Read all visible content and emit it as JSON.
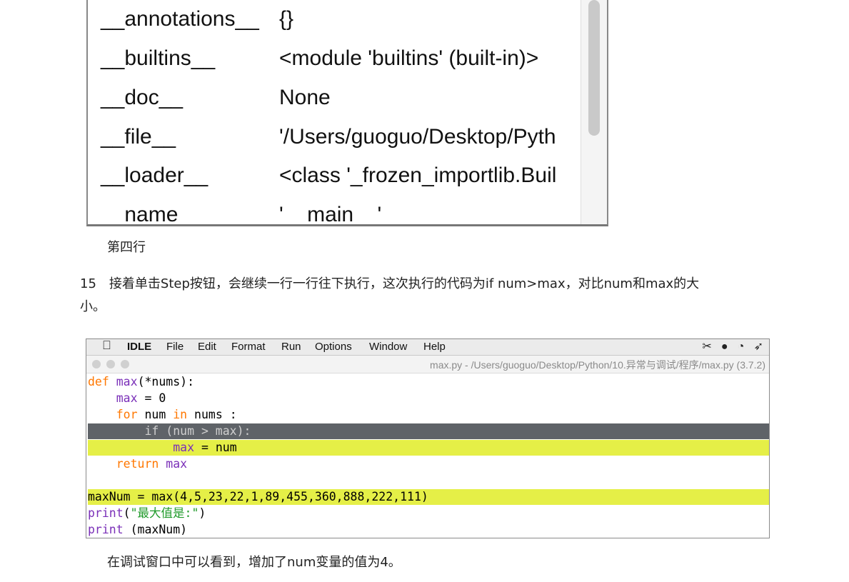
{
  "variables_panel": {
    "rows": [
      {
        "name": "__annotations__",
        "value": "{}"
      },
      {
        "name": "__builtins__",
        "value": "<module 'builtins' (built-in)>"
      },
      {
        "name": "__doc__",
        "value": "None"
      },
      {
        "name": "__file__",
        "value": "'/Users/guoguo/Desktop/Pyth"
      },
      {
        "name": "__loader__",
        "value": "<class '_frozen_importlib.Buil"
      },
      {
        "name": "__name__",
        "value": "'__main__'"
      }
    ]
  },
  "caption_top": "第四行",
  "step_paragraph": {
    "line1": "15　接着单击Step按钮，会继续一行一行往下执行，这次执行的代码为if num>max，对比num和max的大",
    "line2": "小。"
  },
  "idle_window": {
    "menu": {
      "apple_icon": "",
      "items": [
        "IDLE",
        "File",
        "Edit",
        "Format",
        "Run",
        "Options",
        "Window",
        "Help"
      ]
    },
    "tray_icons": [
      "scissors-icon",
      "wechat-icon",
      "qq-icon",
      "bird-icon"
    ],
    "title": "max.py - /Users/guoguo/Desktop/Python/10.异常与调试/程序/max.py (3.7.2)",
    "code": {
      "l1_kw": "def",
      "l1_fn": "max",
      "l1_rest": "(*nums):",
      "l2_indent": "    ",
      "l2_fn": "max",
      "l2_rest": " = 0",
      "l3_indent": "    ",
      "l3_kw1": "for",
      "l3_mid": " num ",
      "l3_kw2": "in",
      "l3_rest": " nums :",
      "l4_text": "        if (num > max):",
      "l5_indent": "            ",
      "l5_fn": "max",
      "l5_rest": " = num",
      "l6_indent": "    ",
      "l6_kw": "return",
      "l6_sp": " ",
      "l6_fn": "max",
      "l8_text": "maxNum = max(4,5,23,22,1,89,455,360,888,222,111)",
      "l9_fn": "print",
      "l9_p1": "(",
      "l9_str": "\"最大值是:\"",
      "l9_p2": ")",
      "l10_fn": "print",
      "l10_rest": " (maxNum)"
    }
  },
  "caption_bottom": "在调试窗口中可以看到，增加了num变量的值为4。"
}
